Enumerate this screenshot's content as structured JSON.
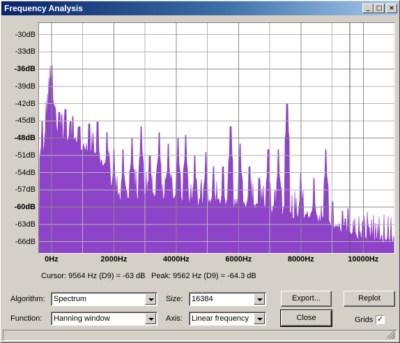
{
  "window": {
    "title": "Frequency Analysis",
    "controls": {
      "minimize": "_",
      "maximize": "□",
      "close": "×"
    }
  },
  "chart_data": {
    "type": "area",
    "color": "#8e44c8",
    "grid": true,
    "xlim": [
      -400,
      11000
    ],
    "ylim": [
      -68,
      -28
    ],
    "y_ticks": [
      {
        "label": "-30dB",
        "value": -30,
        "bold": false
      },
      {
        "label": "-33dB",
        "value": -33,
        "bold": false
      },
      {
        "label": "-36dB",
        "value": -36,
        "bold": true
      },
      {
        "label": "-39dB",
        "value": -39,
        "bold": false
      },
      {
        "label": "-42dB",
        "value": -42,
        "bold": false
      },
      {
        "label": "-45dB",
        "value": -45,
        "bold": false
      },
      {
        "label": "-48dB",
        "value": -48,
        "bold": true
      },
      {
        "label": "-51dB",
        "value": -51,
        "bold": false
      },
      {
        "label": "-54dB",
        "value": -54,
        "bold": false
      },
      {
        "label": "-57dB",
        "value": -57,
        "bold": false
      },
      {
        "label": "-60dB",
        "value": -60,
        "bold": true
      },
      {
        "label": "-63dB",
        "value": -63,
        "bold": false
      },
      {
        "label": "-66dB",
        "value": -66,
        "bold": false
      }
    ],
    "x_ticks": [
      {
        "label": "0Hz",
        "value": 0
      },
      {
        "label": "2000Hz",
        "value": 2000
      },
      {
        "label": "4000Hz",
        "value": 4000
      },
      {
        "label": "6000Hz",
        "value": 6000
      },
      {
        "label": "8000Hz",
        "value": 8000
      },
      {
        "label": "10000Hz",
        "value": 10000
      }
    ],
    "cursor_hz": 9564,
    "envelope": [
      [
        -400,
        -68
      ],
      [
        -300,
        -55
      ],
      [
        -200,
        -46
      ],
      [
        -100,
        -42
      ],
      [
        -40,
        -37.5
      ],
      [
        0,
        -36.5
      ],
      [
        40,
        -39
      ],
      [
        100,
        -44
      ],
      [
        200,
        -46
      ],
      [
        400,
        -47
      ],
      [
        600,
        -47.5
      ],
      [
        800,
        -48
      ],
      [
        1000,
        -48.5
      ],
      [
        1200,
        -49
      ],
      [
        1400,
        -50
      ],
      [
        1600,
        -51.5
      ],
      [
        1800,
        -53
      ],
      [
        1900,
        -55
      ],
      [
        2000,
        -56
      ],
      [
        2100,
        -57
      ],
      [
        2500,
        -57
      ],
      [
        3000,
        -57.3
      ],
      [
        3500,
        -57.6
      ],
      [
        4000,
        -57.8
      ],
      [
        4500,
        -58
      ],
      [
        5000,
        -58.2
      ],
      [
        5500,
        -58.5
      ],
      [
        6000,
        -58.5
      ],
      [
        6500,
        -59
      ],
      [
        7000,
        -59.5
      ],
      [
        7500,
        -60
      ],
      [
        8000,
        -60.5
      ],
      [
        8500,
        -61
      ],
      [
        9000,
        -62
      ],
      [
        9500,
        -63.5
      ],
      [
        10000,
        -64.3
      ],
      [
        10500,
        -64.6
      ],
      [
        11000,
        -64.8
      ]
    ],
    "peaks": [
      [
        -300,
        -45
      ],
      [
        100,
        -42.5
      ],
      [
        250,
        -43.5
      ],
      [
        450,
        -43
      ],
      [
        620,
        -45
      ],
      [
        900,
        -46
      ],
      [
        1200,
        -45.5
      ],
      [
        1480,
        -45.2
      ],
      [
        1780,
        -47
      ],
      [
        2000,
        -50
      ],
      [
        2300,
        -50
      ],
      [
        2580,
        -48
      ],
      [
        2880,
        -46
      ],
      [
        3150,
        -51
      ],
      [
        3450,
        -47
      ],
      [
        3750,
        -49
      ],
      [
        4060,
        -48
      ],
      [
        4300,
        -47.5
      ],
      [
        4600,
        -51
      ],
      [
        4950,
        -50.5
      ],
      [
        5200,
        -53
      ],
      [
        5500,
        -53
      ],
      [
        5750,
        -46
      ],
      [
        6050,
        -49
      ],
      [
        6350,
        -53
      ],
      [
        6660,
        -55
      ],
      [
        6950,
        -50
      ],
      [
        7280,
        -50
      ],
      [
        7560,
        -42
      ],
      [
        8000,
        -54
      ],
      [
        8420,
        -55
      ],
      [
        8800,
        -50
      ],
      [
        9000,
        -59
      ],
      [
        9420,
        -62
      ],
      [
        9562,
        -64.3
      ],
      [
        10180,
        -63.5
      ]
    ]
  },
  "status": {
    "cursor": "Cursor: 9564 Hz (D9) = -63 dB",
    "peak": "Peak: 9562 Hz (D9) = -64.3 dB"
  },
  "controls": {
    "algorithm_label": "Algorithm:",
    "algorithm_value": "Spectrum",
    "size_label": "Size:",
    "size_value": "16384",
    "function_label": "Function:",
    "function_value": "Hanning window",
    "axis_label": "Axis:",
    "axis_value": "Linear frequency",
    "export_button": "Export...",
    "replot_button": "Replot",
    "close_button": "Close",
    "grids_label": "Grids",
    "grids_checked": "✓"
  }
}
